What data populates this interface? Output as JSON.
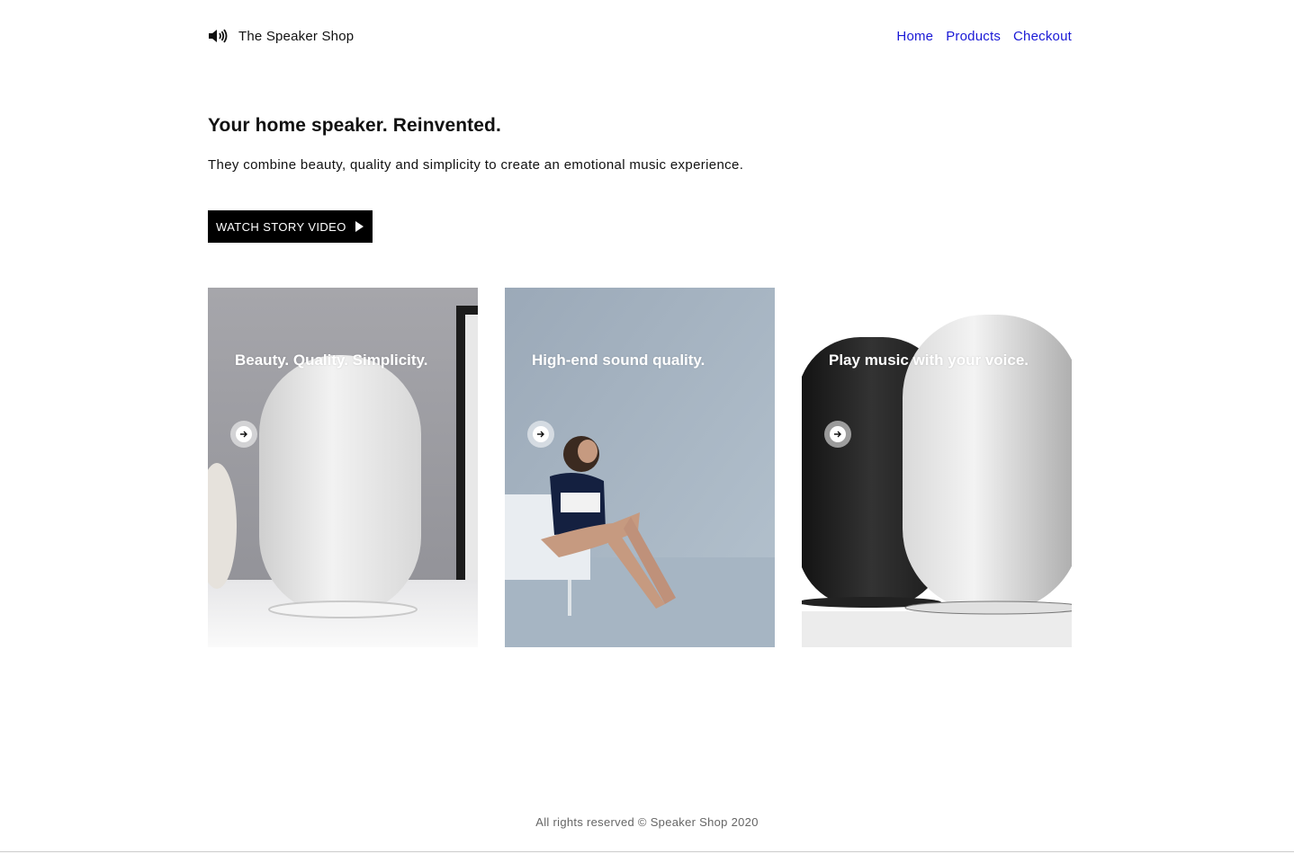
{
  "header": {
    "brand_icon": "speaker-volume-icon",
    "brand_name": "The Speaker Shop",
    "nav": [
      {
        "label": "Home"
      },
      {
        "label": "Products"
      },
      {
        "label": "Checkout"
      }
    ],
    "link_color": "#1a19d6"
  },
  "hero": {
    "title": "Your home speaker. Reinvented.",
    "subtitle": "They combine beauty, quality and simplicity to create an emotional music experience.",
    "cta_label": "WATCH STORY VIDEO",
    "cta_icon": "play-icon"
  },
  "cards": [
    {
      "title": "Beauty. Quality. Simplicity.",
      "icon": "arrow-right-icon"
    },
    {
      "title": "High-end sound quality.",
      "icon": "arrow-right-icon"
    },
    {
      "title": "Play music with your voice.",
      "icon": "arrow-right-icon"
    }
  ],
  "footer": {
    "text": "All rights reserved © Speaker Shop 2020"
  }
}
